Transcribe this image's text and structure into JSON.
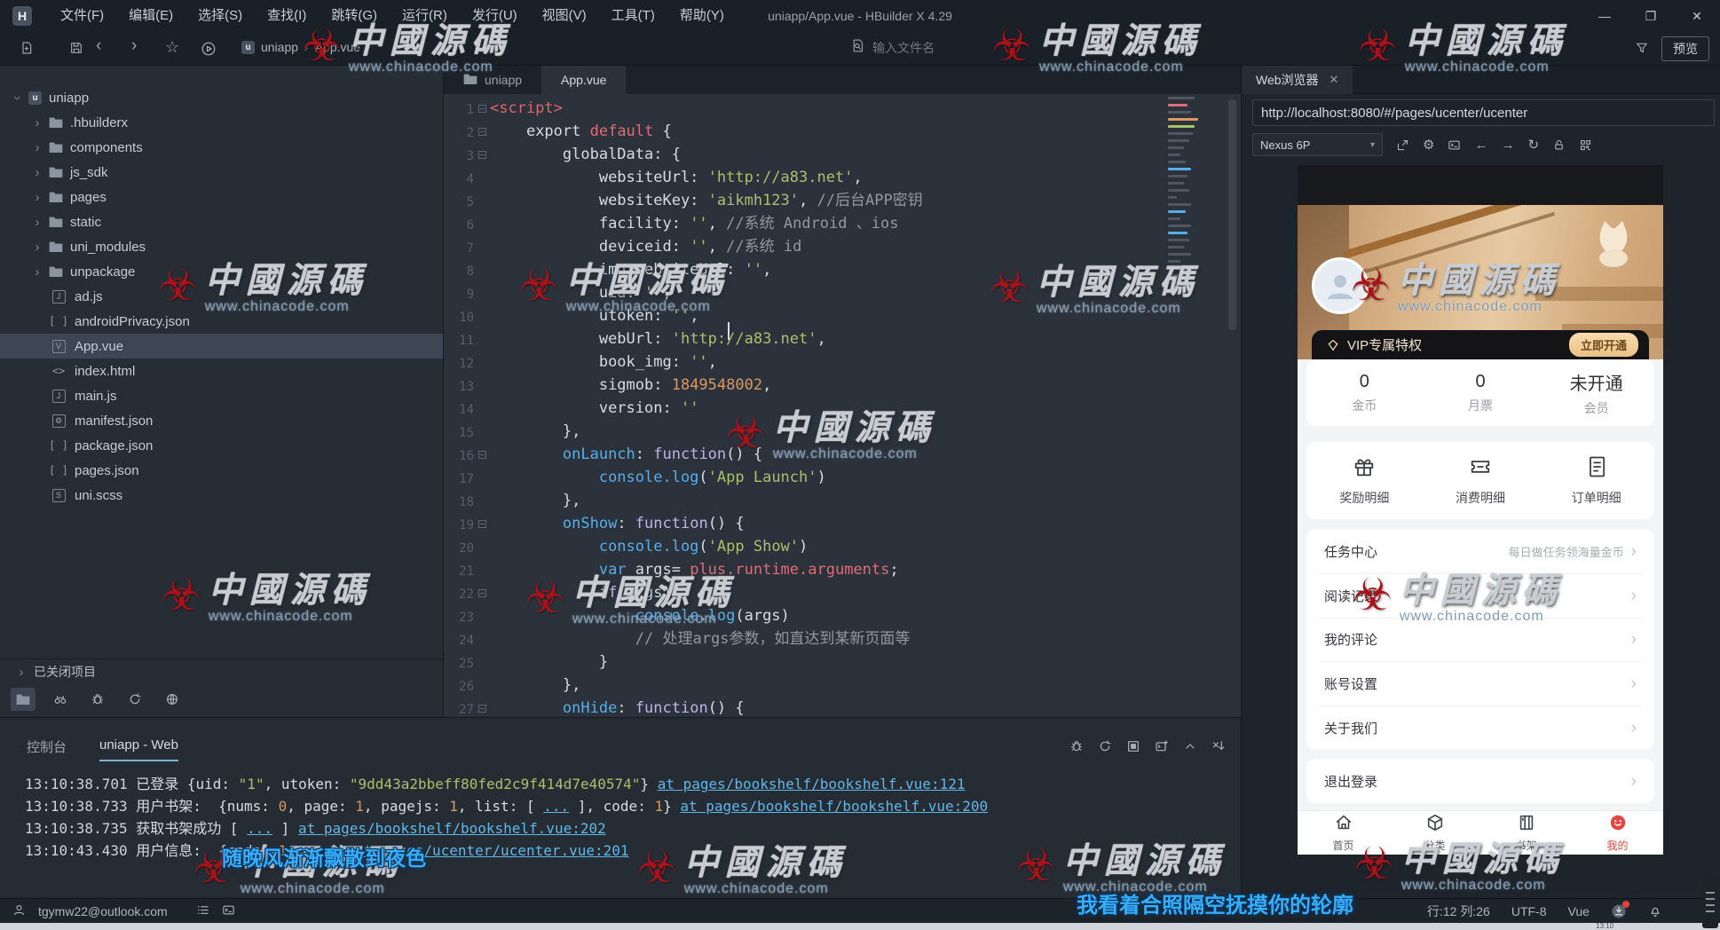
{
  "window": {
    "logo": "H",
    "menus": [
      "文件(F)",
      "编辑(E)",
      "选择(S)",
      "查找(I)",
      "跳转(G)",
      "运行(R)",
      "发行(U)",
      "视图(V)",
      "工具(T)",
      "帮助(Y)"
    ],
    "title": "uniapp/App.vue - HBuilder X 4.29"
  },
  "toolbar": {
    "breadcrumb_project": "uniapp",
    "breadcrumb_file": "App.vue",
    "search_placeholder": "输入文件名",
    "preview_label": "预览"
  },
  "sidebar": {
    "closed_projects": "已关闭项目",
    "items": [
      {
        "kind": "project",
        "label": "uniapp"
      },
      {
        "kind": "folder",
        "label": ".hbuilderx"
      },
      {
        "kind": "folder",
        "label": "components"
      },
      {
        "kind": "folder",
        "label": "js_sdk"
      },
      {
        "kind": "folder",
        "label": "pages"
      },
      {
        "kind": "folder",
        "label": "static"
      },
      {
        "kind": "folder",
        "label": "uni_modules"
      },
      {
        "kind": "folder",
        "label": "unpackage"
      },
      {
        "kind": "file",
        "ft": "js",
        "label": "ad.js"
      },
      {
        "kind": "file",
        "ft": "json",
        "label": "androidPrivacy.json"
      },
      {
        "kind": "file",
        "ft": "vue",
        "label": "App.vue",
        "selected": true
      },
      {
        "kind": "file",
        "ft": "html",
        "label": "index.html"
      },
      {
        "kind": "file",
        "ft": "js",
        "label": "main.js"
      },
      {
        "kind": "file",
        "ft": "manifest",
        "label": "manifest.json"
      },
      {
        "kind": "file",
        "ft": "json",
        "label": "package.json"
      },
      {
        "kind": "file",
        "ft": "json",
        "label": "pages.json"
      },
      {
        "kind": "file",
        "ft": "scss",
        "label": "uni.scss"
      }
    ]
  },
  "editor": {
    "tabs": [
      {
        "label": "uniapp"
      },
      {
        "label": "App.vue"
      }
    ],
    "lines": [
      {
        "n": 1,
        "i": 0,
        "f": true,
        "s": [
          [
            "<script>",
            "tag"
          ]
        ]
      },
      {
        "n": 2,
        "i": 1,
        "f": true,
        "s": [
          [
            "export ",
            "fg"
          ],
          [
            "default",
            "red"
          ],
          [
            " {",
            "fg"
          ]
        ]
      },
      {
        "n": 3,
        "i": 2,
        "f": true,
        "s": [
          [
            "globalData: {",
            "fg"
          ]
        ]
      },
      {
        "n": 4,
        "i": 3,
        "f": false,
        "s": [
          [
            "websiteUrl: ",
            "fg"
          ],
          [
            "'http://a83.net'",
            "str"
          ],
          [
            ",",
            "fg"
          ]
        ]
      },
      {
        "n": 5,
        "i": 3,
        "f": false,
        "s": [
          [
            "websiteKey: ",
            "fg"
          ],
          [
            "'aikmh123'",
            "str"
          ],
          [
            ", ",
            "fg"
          ],
          [
            "//后台APP密钥",
            "com"
          ]
        ]
      },
      {
        "n": 6,
        "i": 3,
        "f": false,
        "s": [
          [
            "facility: ",
            "fg"
          ],
          [
            "''",
            "str"
          ],
          [
            ", ",
            "fg"
          ],
          [
            "//系统 Android 、ios",
            "com"
          ]
        ]
      },
      {
        "n": 7,
        "i": 3,
        "f": false,
        "s": [
          [
            "deviceid: ",
            "fg"
          ],
          [
            "''",
            "str"
          ],
          [
            ", ",
            "fg"
          ],
          [
            "//系统 id",
            "com"
          ]
        ]
      },
      {
        "n": 8,
        "i": 3,
        "f": false,
        "s": [
          [
            "img_websiteUrl: ",
            "fg"
          ],
          [
            "''",
            "str"
          ],
          [
            ",",
            "fg"
          ]
        ]
      },
      {
        "n": 9,
        "i": 3,
        "f": false,
        "s": [
          [
            "uid: ",
            "fg"
          ],
          [
            "''",
            "str"
          ],
          [
            ",",
            "fg"
          ]
        ]
      },
      {
        "n": 10,
        "i": 3,
        "f": false,
        "s": [
          [
            "utoken: ",
            "fg"
          ],
          [
            "''",
            "str"
          ],
          [
            ",",
            "fg"
          ]
        ]
      },
      {
        "n": 11,
        "i": 3,
        "f": false,
        "s": [
          [
            "webUrl: ",
            "fg"
          ],
          [
            "'http://a83.net'",
            "str"
          ],
          [
            ",",
            "fg"
          ]
        ]
      },
      {
        "n": 12,
        "i": 3,
        "f": false,
        "s": [
          [
            "book_img: ",
            "fg"
          ],
          [
            "''",
            "str"
          ],
          [
            ",",
            "fg"
          ]
        ]
      },
      {
        "n": 13,
        "i": 3,
        "f": false,
        "s": [
          [
            "sigmob: ",
            "fg"
          ],
          [
            "1849548002",
            "num"
          ],
          [
            ",",
            "fg"
          ]
        ]
      },
      {
        "n": 14,
        "i": 3,
        "f": false,
        "s": [
          [
            "version: ",
            "fg"
          ],
          [
            "''",
            "str"
          ]
        ]
      },
      {
        "n": 15,
        "i": 2,
        "f": false,
        "s": [
          [
            "},",
            "fg"
          ]
        ]
      },
      {
        "n": 16,
        "i": 2,
        "f": true,
        "s": [
          [
            "onLaunch",
            "blue"
          ],
          [
            ": ",
            "fg"
          ],
          [
            "function",
            "kw"
          ],
          [
            "() {",
            "fg"
          ]
        ]
      },
      {
        "n": 17,
        "i": 3,
        "f": false,
        "s": [
          [
            "console.log",
            "blue"
          ],
          [
            "(",
            "fg"
          ],
          [
            "'App Launch'",
            "str"
          ],
          [
            ")",
            "fg"
          ]
        ]
      },
      {
        "n": 18,
        "i": 2,
        "f": false,
        "s": [
          [
            "},",
            "fg"
          ]
        ]
      },
      {
        "n": 19,
        "i": 2,
        "f": true,
        "s": [
          [
            "onShow",
            "blue"
          ],
          [
            ": ",
            "fg"
          ],
          [
            "function",
            "kw"
          ],
          [
            "() {",
            "fg"
          ]
        ]
      },
      {
        "n": 20,
        "i": 3,
        "f": false,
        "s": [
          [
            "console.log",
            "blue"
          ],
          [
            "(",
            "fg"
          ],
          [
            "'App Show'",
            "str"
          ],
          [
            ")",
            "fg"
          ]
        ]
      },
      {
        "n": 21,
        "i": 3,
        "f": false,
        "s": [
          [
            "var",
            "blue"
          ],
          [
            " args= ",
            "fg"
          ],
          [
            "plus.runtime.arguments",
            "red"
          ],
          [
            ";",
            "fg"
          ]
        ]
      },
      {
        "n": 22,
        "i": 3,
        "f": true,
        "s": [
          [
            "if",
            "kw"
          ],
          [
            "(args){",
            "fg"
          ]
        ]
      },
      {
        "n": 23,
        "i": 4,
        "f": false,
        "s": [
          [
            "console.log",
            "blue"
          ],
          [
            "(args)",
            "fg"
          ]
        ]
      },
      {
        "n": 24,
        "i": 4,
        "f": false,
        "s": [
          [
            "// 处理args参数，如直达到某新页面等",
            "com"
          ]
        ]
      },
      {
        "n": 25,
        "i": 3,
        "f": false,
        "s": [
          [
            "}",
            "fg"
          ]
        ]
      },
      {
        "n": 26,
        "i": 2,
        "f": false,
        "s": [
          [
            "},",
            "fg"
          ]
        ]
      },
      {
        "n": 27,
        "i": 2,
        "f": true,
        "s": [
          [
            "onHide",
            "blue"
          ],
          [
            ": ",
            "fg"
          ],
          [
            "function",
            "kw"
          ],
          [
            "() {",
            "fg"
          ]
        ]
      }
    ]
  },
  "browser": {
    "tab_label": "Web浏览器",
    "url": "http://localhost:8080/#/pages/ucenter/ucenter",
    "device": "Nexus 6P",
    "page": {
      "vip_title": "VIP专属特权",
      "vip_button": "立即开通",
      "stats": [
        {
          "value": "0",
          "label": "金币"
        },
        {
          "value": "0",
          "label": "月票"
        },
        {
          "value": "未开通",
          "label": "会员"
        }
      ],
      "shortcuts": [
        {
          "icon": "gift",
          "label": "奖励明细"
        },
        {
          "icon": "coupon",
          "label": "消费明细"
        },
        {
          "icon": "order",
          "label": "订单明细"
        }
      ],
      "menu": [
        {
          "label": "任务中心",
          "note": "每日做任务领海量金币"
        },
        {
          "label": "阅读记录",
          "note": ""
        },
        {
          "label": "我的评论",
          "note": ""
        },
        {
          "label": "账号设置",
          "note": ""
        },
        {
          "label": "关于我们",
          "note": ""
        }
      ],
      "logout": "退出登录",
      "tabbar": [
        {
          "icon": "home",
          "label": "首页",
          "active": false
        },
        {
          "icon": "category",
          "label": "分类",
          "active": false
        },
        {
          "icon": "shelf",
          "label": "书架",
          "active": false
        },
        {
          "icon": "mine",
          "label": "我的",
          "active": true
        }
      ]
    }
  },
  "console": {
    "label": "控制台",
    "tab": "uniapp - Web",
    "logs": [
      {
        "time": "13:10:38.701",
        "parts": [
          [
            "已登录 {uid: ",
            "fg"
          ],
          [
            "\"1\"",
            "str"
          ],
          [
            ", utoken: ",
            "fg"
          ],
          [
            "\"9dd43a2bbeff80fed2c9f414d7e40574\"",
            "str"
          ],
          [
            "} ",
            "fg"
          ]
        ],
        "link": "at pages/bookshelf/bookshelf.vue:121"
      },
      {
        "time": "13:10:38.733",
        "parts": [
          [
            "用户书架:  {nums: ",
            "fg"
          ],
          [
            "0",
            "num"
          ],
          [
            ", page: ",
            "fg"
          ],
          [
            "1",
            "num"
          ],
          [
            ", pagejs: ",
            "fg"
          ],
          [
            "1",
            "num"
          ],
          [
            ", list: [ ",
            "fg"
          ],
          [
            "...",
            "lk"
          ],
          [
            " ], code: ",
            "fg"
          ],
          [
            "1",
            "num"
          ],
          [
            "} ",
            "fg"
          ]
        ],
        "link": "at pages/bookshelf/bookshelf.vue:200"
      },
      {
        "time": "13:10:38.735",
        "parts": [
          [
            "获取书架成功 [ ",
            "fg"
          ],
          [
            "...",
            "lk"
          ],
          [
            " ] ",
            "fg"
          ]
        ],
        "link": "at pages/bookshelf/bookshelf.vue:202"
      },
      {
        "time": "13:10:43.430",
        "parts": [
          [
            "用户信息:  {code: ",
            "fg"
          ],
          [
            "1",
            "num"
          ],
          [
            ", ",
            "fg"
          ],
          [
            "...",
            "lk"
          ],
          [
            " } ",
            "fg"
          ]
        ],
        "link": "at pages/ucenter/ucenter.vue:201"
      }
    ]
  },
  "statusbar": {
    "account": "tgymw22@outlook.com",
    "line_col": "行:12 列:26",
    "encoding": "UTF-8",
    "filetype": "Vue"
  },
  "overlay": {
    "watermark_text": "中國源碼",
    "watermark_url": "www.chinacode.com",
    "lyric_console": "随晚风渐渐飘散到夜色",
    "lyric_status": "我看着合照隔空抚摸你的轮廓",
    "taskbar_time": "13:10"
  }
}
